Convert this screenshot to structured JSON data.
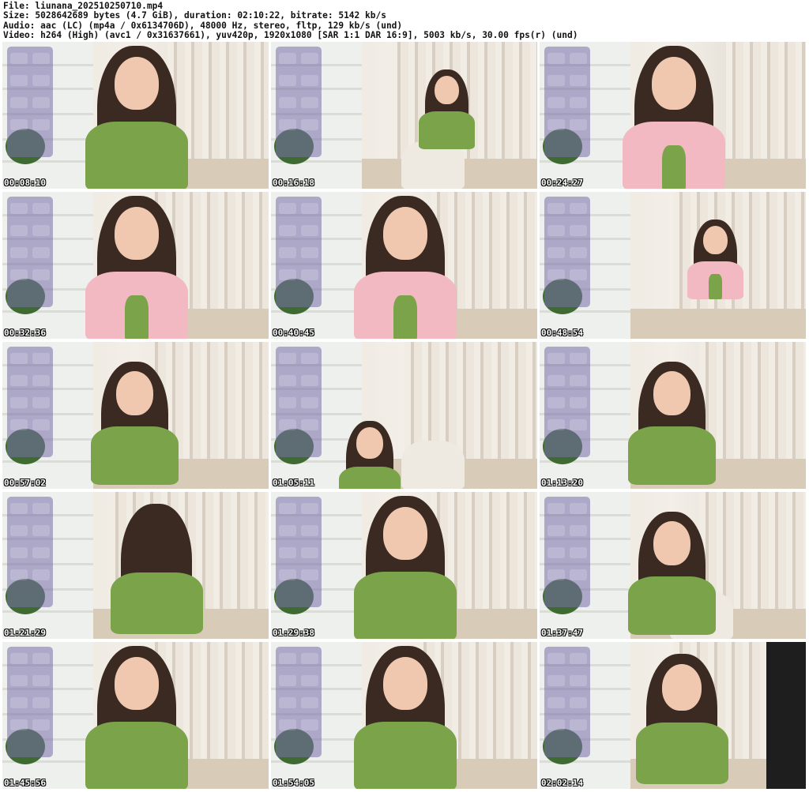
{
  "header": {
    "file": "File: liunana_202510250710.mp4",
    "size": "Size: 5028642689 bytes (4.7 GiB), duration: 02:10:22, bitrate: 5142 kb/s",
    "audio": "Audio: aac (LC) (mp4a / 0x6134706D), 48000 Hz, stereo, fltp, 129 kb/s (und)",
    "video": "Video: h264 (High) (avc1 / 0x31637661), yuv420p, 1920x1080 [SAR 1:1 DAR 16:9], 5003 kb/s, 30.00 fps(r) (und)"
  },
  "thumbnails": [
    {
      "timestamp": "00:08:10"
    },
    {
      "timestamp": "00:16:18"
    },
    {
      "timestamp": "00:24:27"
    },
    {
      "timestamp": "00:32:36"
    },
    {
      "timestamp": "00:40:45"
    },
    {
      "timestamp": "00:48:54"
    },
    {
      "timestamp": "00:57:02"
    },
    {
      "timestamp": "01:05:11"
    },
    {
      "timestamp": "01:13:20"
    },
    {
      "timestamp": "01:21:29"
    },
    {
      "timestamp": "01:29:38"
    },
    {
      "timestamp": "01:37:47"
    },
    {
      "timestamp": "01:45:56"
    },
    {
      "timestamp": "01:54:05"
    },
    {
      "timestamp": "02:02:14"
    }
  ],
  "colors": {
    "background": "#ffffff",
    "header_text": "#111111",
    "timestamp_text": "#ffffff",
    "dress_green": "#7aa34a",
    "cardigan_pink": "#f2b9c2"
  }
}
